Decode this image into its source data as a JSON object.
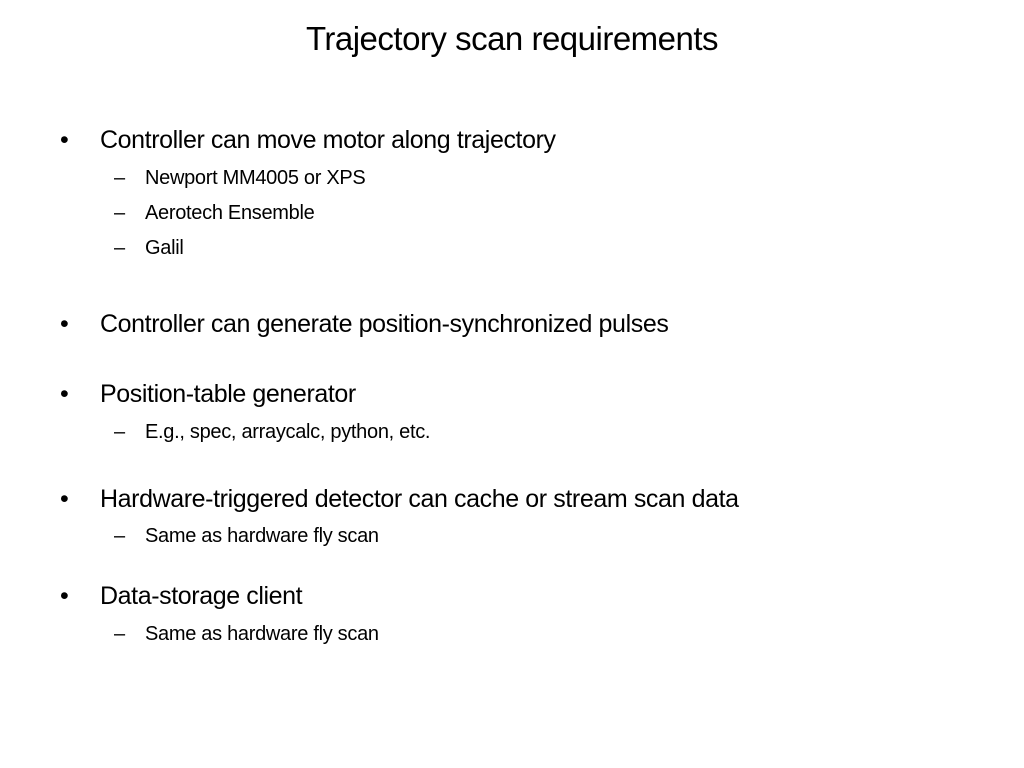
{
  "slide": {
    "title": "Trajectory scan requirements",
    "bullet_glyph": "•",
    "dash_glyph": "–",
    "items": [
      {
        "text": "Controller can move motor along trajectory",
        "subitems": [
          "Newport MM4005 or XPS",
          "Aerotech Ensemble",
          "Galil"
        ]
      },
      {
        "text": "Controller can generate position-synchronized pulses",
        "subitems": []
      },
      {
        "text": "Position-table generator",
        "subitems": [
          "E.g., spec, arraycalc, python, etc."
        ]
      },
      {
        "text": "Hardware-triggered detector can cache or stream scan data",
        "subitems": [
          "Same as hardware fly scan"
        ]
      },
      {
        "text": "Data-storage client",
        "subitems": [
          "Same as hardware fly scan"
        ]
      }
    ]
  }
}
